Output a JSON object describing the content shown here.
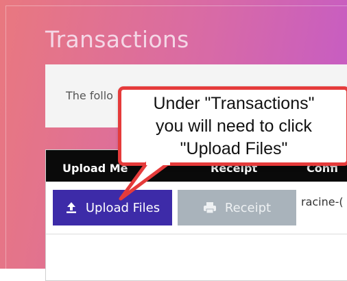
{
  "page": {
    "title": "Transactions",
    "info_text": "The follo"
  },
  "table": {
    "headers": [
      "Upload Me",
      "Receipt",
      "Confi"
    ],
    "row": {
      "upload_button": {
        "label": "Upload Files",
        "icon": "upload-icon"
      },
      "receipt_button": {
        "label": "Receipt",
        "icon": "printer-icon"
      },
      "file_name": "racine-("
    }
  },
  "callout": {
    "text": "Under \"Transactions\"\nyou will need to click\n\"Upload Files\""
  },
  "colors": {
    "background_start": "#e9787f",
    "background_end": "#c35ac8",
    "upload_button": "#3d2ba8",
    "receipt_button": "#a9b3bb",
    "header": "#0a0a0a",
    "callout_border": "#e53b3b"
  }
}
